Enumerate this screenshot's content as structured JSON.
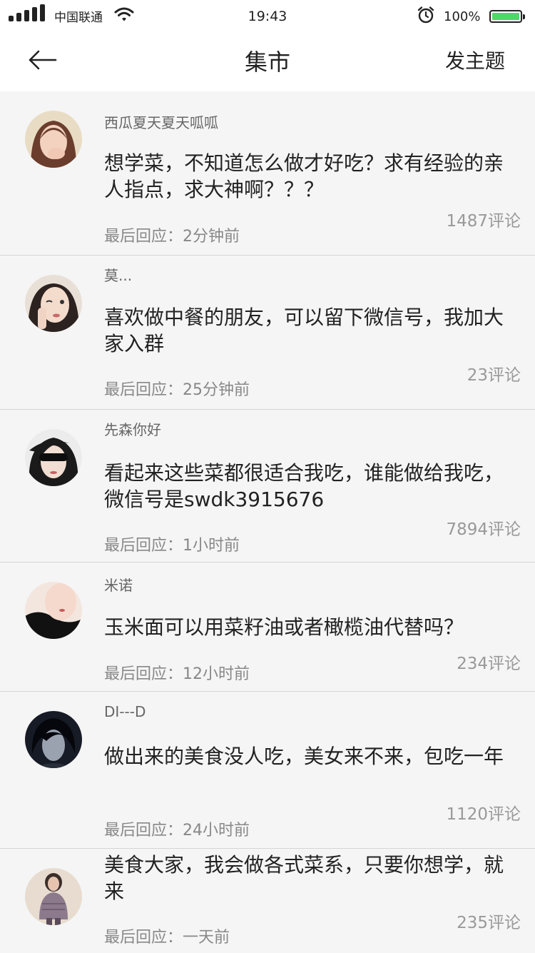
{
  "status": {
    "carrier": "中国联通",
    "time": "19:43",
    "battery": "100%"
  },
  "nav": {
    "title": "集市",
    "action": "发主题"
  },
  "posts": [
    {
      "user": "西瓜夏天夏天呱呱",
      "text": "想学菜，不知道怎么做才好吃？求有经验的亲人指点，求大神啊？？？",
      "comments": "1487评论",
      "last_reply": "最后回应：2分钟前"
    },
    {
      "user": "莫...",
      "text": "喜欢做中餐的朋友，可以留下微信号，我加大家入群",
      "comments": "23评论",
      "last_reply": "最后回应：25分钟前"
    },
    {
      "user": "先森你好",
      "text": "看起来这些菜都很适合我吃，谁能做给我吃，微信号是swdk3915676",
      "comments": "7894评论",
      "last_reply": "最后回应：1小时前"
    },
    {
      "user": "米诺",
      "text": "玉米面可以用菜籽油或者橄榄油代替吗？",
      "comments": "234评论",
      "last_reply": "最后回应：12小时前"
    },
    {
      "user": "DI---D",
      "text": "做出来的美食没人吃，美女来不来，包吃一年",
      "comments": "1120评论",
      "last_reply": "最后回应：24小时前"
    },
    {
      "user": "",
      "text": "美食大家，我会做各式菜系，只要你想学，就来",
      "comments": "235评论",
      "last_reply": "最后回应：一天前"
    }
  ]
}
